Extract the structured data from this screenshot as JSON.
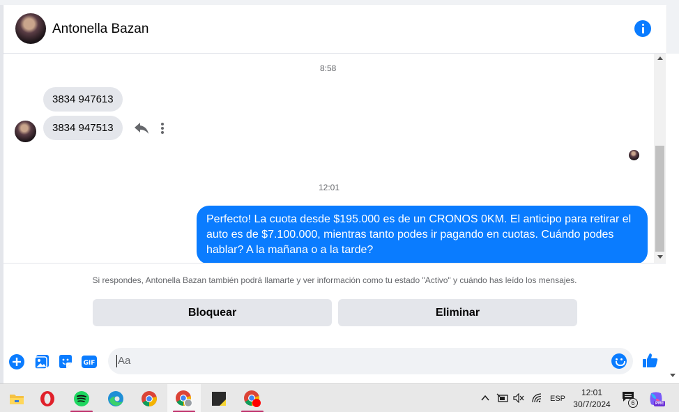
{
  "header": {
    "contact_name": "Antonella Bazan"
  },
  "thread": {
    "time_1": "8:58",
    "incoming": [
      "3834 947613",
      "3834 947513"
    ],
    "time_2": "12:01",
    "outgoing": "Perfecto! La cuota desde $195.000 es de un CRONOS 0KM. El anticipo para retirar el auto es de $7.100.000, mientras tanto podes ir pagando en cuotas. Cuándo podes hablar? A la mañana o a la tarde?"
  },
  "notice": {
    "text": "Si respondes, Antonella Bazan también podrá llamarte y ver información como tu estado \"Activo\" y cuándo has leído los mensajes.",
    "block_label": "Bloquear",
    "delete_label": "Eliminar"
  },
  "composer": {
    "placeholder": "Aa",
    "gif_label": "GIF"
  },
  "taskbar": {
    "lang": "ESP",
    "time": "12:01",
    "date": "30/7/2024",
    "notification_count": "6",
    "pre_badge": "PRE"
  },
  "colors": {
    "accent": "#0a7cff",
    "bubble_in": "#e4e6eb",
    "spotify": "#1ed760",
    "opera": "#e0202a"
  }
}
